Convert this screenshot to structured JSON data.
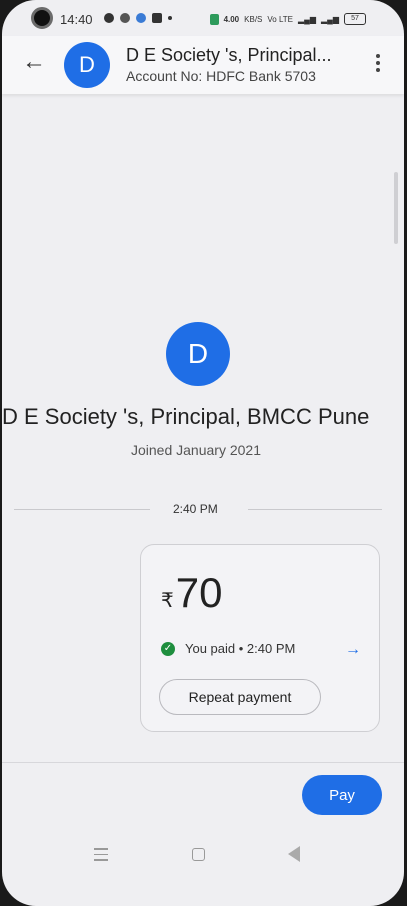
{
  "status_bar": {
    "time": "14:40",
    "network_speed": "4.00",
    "network_unit": "KB/S",
    "network_labels": "Vo LTE",
    "battery": "57"
  },
  "header": {
    "avatar_letter": "D",
    "title": "D E Society 's, Principal...",
    "subtitle": "Account No: HDFC Bank 5703"
  },
  "profile": {
    "avatar_letter": "D",
    "name": "D E Society 's, Principal, BMCC Pune",
    "joined": "Joined January 2021"
  },
  "transaction": {
    "time_label": "2:40 PM",
    "currency_symbol": "₹",
    "amount": "70",
    "status_text": "You paid • 2:40 PM",
    "repeat_label": "Repeat payment"
  },
  "footer": {
    "pay_label": "Pay"
  },
  "colors": {
    "accent": "#1f6ee6",
    "success": "#1e8e3e",
    "background": "#efeff2"
  }
}
